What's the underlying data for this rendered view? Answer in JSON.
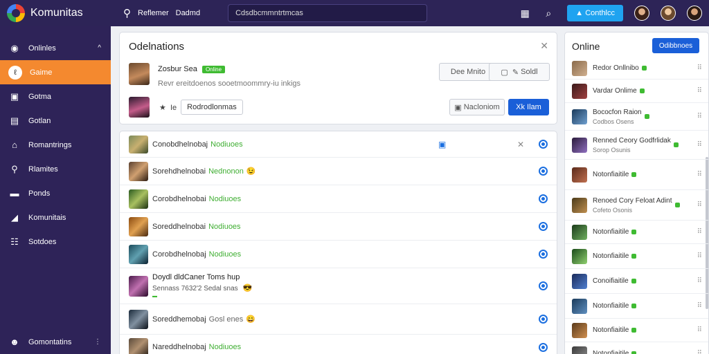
{
  "topbar": {
    "brand": "Komunitas",
    "links": [
      "Reflemer",
      "Dadmd"
    ],
    "search_value": "Cdsdbcmmntrtmcas",
    "button_label": "Conthlcc",
    "icons": [
      "apps-icon",
      "zoom-icon"
    ]
  },
  "sidebar": {
    "items": [
      {
        "label": "Onlinles",
        "icon": "globe-icon",
        "active": false
      },
      {
        "label": "Gaime",
        "icon": "game-icon",
        "active": true
      },
      {
        "label": "Gotma",
        "icon": "folder-icon",
        "active": false
      },
      {
        "label": "Gotlan",
        "icon": "book-icon",
        "active": false
      },
      {
        "label": "Romantrings",
        "icon": "home-icon",
        "active": false
      },
      {
        "label": "Rlamites",
        "icon": "chat-icon",
        "active": false
      },
      {
        "label": "Ponds",
        "icon": "card-icon",
        "active": false
      },
      {
        "label": "Komunitais",
        "icon": "chart-icon",
        "active": false
      },
      {
        "label": "Sotdoes",
        "icon": "list-icon",
        "active": false
      }
    ],
    "footer": "Gomontatins"
  },
  "request_panel": {
    "title": "Odelnations",
    "user_name": "Zosbur Sea",
    "user_badge": "Online",
    "user_sub": "Revr ereitdoenos sooetmoommry-iu inkigs",
    "tag_label": "Rodrodlonmas",
    "btn_hide": "Dee Mnito",
    "btn_add": "Soldl",
    "btn_decline": "Nacloniom",
    "btn_accept": "Xk Ilam"
  },
  "list": [
    {
      "name": "Conobdhelnobaj",
      "status": "Nodiuoes",
      "emoji": ""
    },
    {
      "name": "Sorehdhelnobai",
      "status": "Nednonon",
      "emoji": "😉"
    },
    {
      "name": "Corobdhelnobai",
      "status": "Nodiuoes",
      "emoji": ""
    },
    {
      "name": "Soreddhelnobai",
      "status": "Nodiuoes",
      "emoji": ""
    },
    {
      "name": "Corobdhelnobaj",
      "status": "Nodiuoes",
      "emoji": ""
    },
    {
      "name": "Doydl dldCaner Toms hup",
      "status": "Sennass 7632'2 Sedal snas",
      "emoji": "😎"
    },
    {
      "name": "Soreddhemobaj",
      "status": "Gosl enes",
      "emoji": "😄"
    },
    {
      "name": "Nareddhelnobaj",
      "status": "Nodiuoes",
      "emoji": ""
    }
  ],
  "online": {
    "title": "Online",
    "button": "Odibbnoes",
    "items": [
      {
        "name": "Redor Onllnibo",
        "sub": ""
      },
      {
        "name": "Vardar Onlime",
        "sub": ""
      },
      {
        "name": "Bococfon Raion",
        "sub": "Codbos Osens"
      },
      {
        "name": "Renned Ceory Godfrlidak",
        "sub": "Sorop Osunis"
      },
      {
        "name": "Notonfiaitile",
        "sub": ""
      },
      {
        "name": "Renoed Cory Feloat Adint",
        "sub": "Cofeto Osonis"
      },
      {
        "name": "Notonfiaitile",
        "sub": ""
      },
      {
        "name": "Notonfiaitile",
        "sub": ""
      },
      {
        "name": "Conoifiaitile",
        "sub": ""
      },
      {
        "name": "Notonfiaitile",
        "sub": ""
      },
      {
        "name": "Notonfiaitile",
        "sub": ""
      },
      {
        "name": "Notonfiaitile",
        "sub": ""
      }
    ]
  }
}
